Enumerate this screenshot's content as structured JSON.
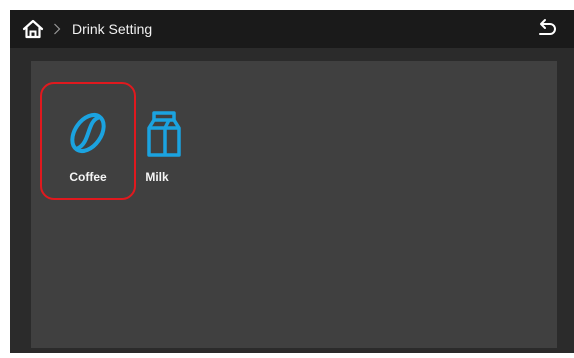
{
  "header": {
    "title": "Drink Setting",
    "home_icon": "home-icon",
    "breadcrumb_icon": "chevron-right-icon",
    "back_icon": "back-arrow-icon"
  },
  "tiles": [
    {
      "label": "Coffee",
      "icon": "coffee-bean-icon",
      "selected": true
    },
    {
      "label": "Milk",
      "icon": "milk-carton-icon",
      "selected": false
    }
  ],
  "colors": {
    "accent": "#1ba3e0",
    "selection": "#e0191e",
    "header_bg": "#1a1a1a",
    "panel_bg": "#404040",
    "screen_bg": "#2b2b2b"
  }
}
